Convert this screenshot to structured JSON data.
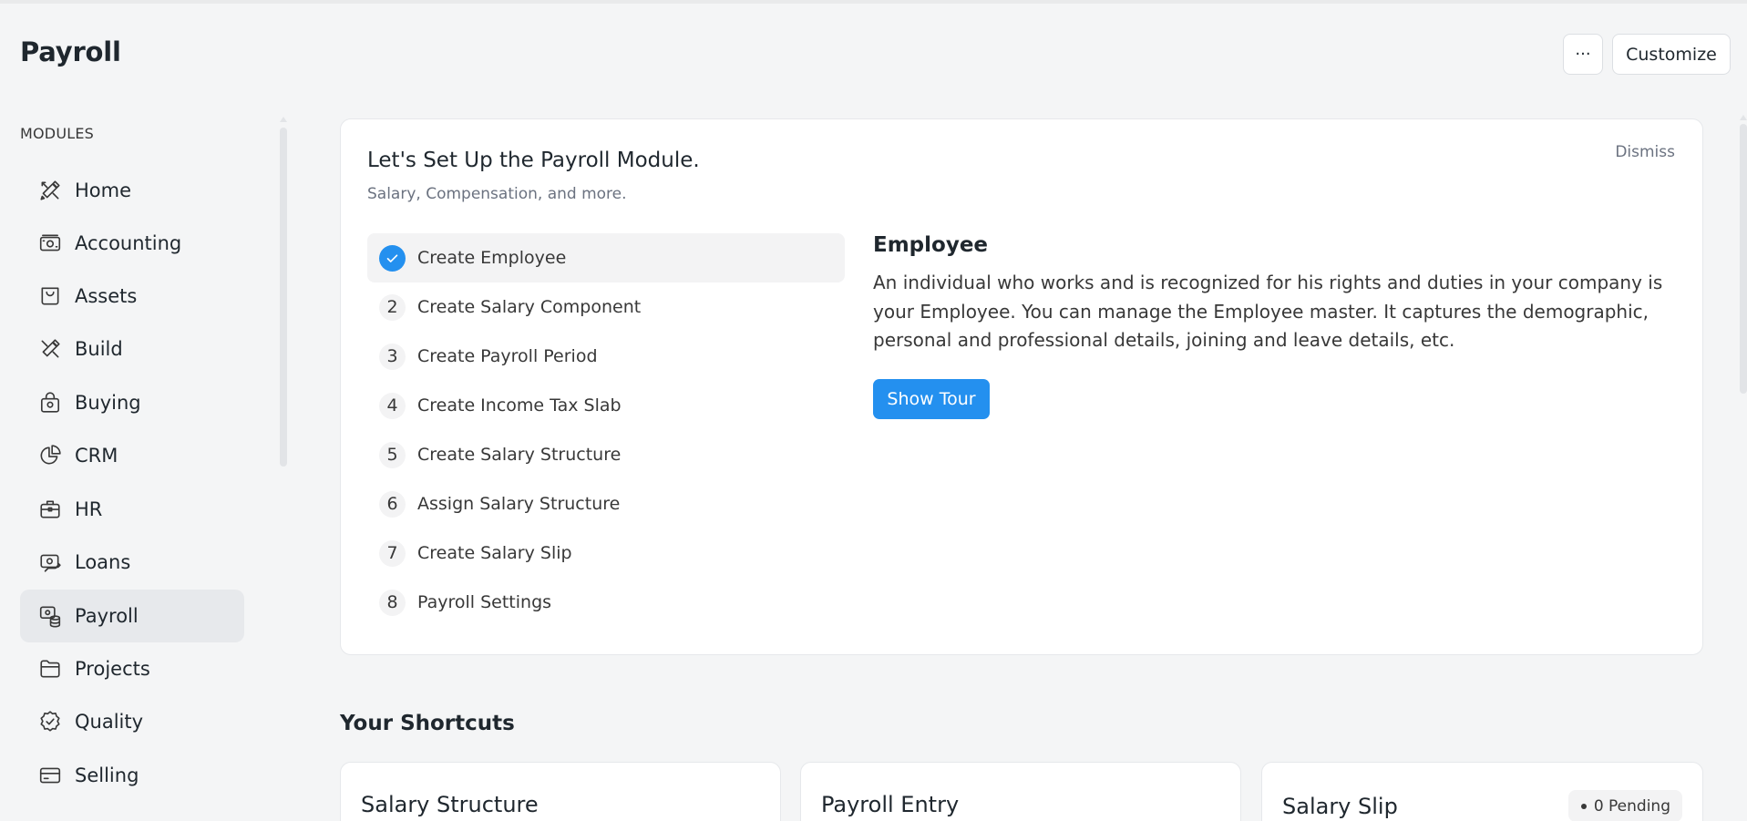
{
  "header": {
    "title": "Payroll",
    "more_label": "···",
    "customize_label": "Customize"
  },
  "sidebar": {
    "section_label": "MODULES",
    "items": [
      {
        "label": "Home",
        "icon": "tools-icon"
      },
      {
        "label": "Accounting",
        "icon": "money-icon"
      },
      {
        "label": "Assets",
        "icon": "bag-icon"
      },
      {
        "label": "Build",
        "icon": "tools-icon"
      },
      {
        "label": "Buying",
        "icon": "basket-icon"
      },
      {
        "label": "CRM",
        "icon": "pie-chart-icon"
      },
      {
        "label": "HR",
        "icon": "briefcase-icon"
      },
      {
        "label": "Loans",
        "icon": "loan-icon"
      },
      {
        "label": "Payroll",
        "icon": "payroll-icon",
        "active": true
      },
      {
        "label": "Projects",
        "icon": "folder-icon"
      },
      {
        "label": "Quality",
        "icon": "quality-badge-icon"
      },
      {
        "label": "Selling",
        "icon": "card-icon"
      }
    ]
  },
  "onboarding": {
    "title": "Let's Set Up the Payroll Module.",
    "subtitle": "Salary, Compensation, and more.",
    "dismiss_label": "Dismiss",
    "steps": [
      {
        "number": "✓",
        "label": "Create Employee",
        "done": true
      },
      {
        "number": "2",
        "label": "Create Salary Component"
      },
      {
        "number": "3",
        "label": "Create Payroll Period"
      },
      {
        "number": "4",
        "label": "Create Income Tax Slab"
      },
      {
        "number": "5",
        "label": "Create Salary Structure"
      },
      {
        "number": "6",
        "label": "Assign Salary Structure"
      },
      {
        "number": "7",
        "label": "Create Salary Slip"
      },
      {
        "number": "8",
        "label": "Payroll Settings"
      }
    ],
    "detail": {
      "title": "Employee",
      "body": "An individual who works and is recognized for his rights and duties in your company is your Employee. You can manage the Employee master. It captures the demographic, personal and professional details, joining and leave details, etc.",
      "button_label": "Show Tour"
    }
  },
  "shortcuts": {
    "title": "Your Shortcuts",
    "items": [
      {
        "label": "Salary Structure"
      },
      {
        "label": "Payroll Entry"
      },
      {
        "label": "Salary Slip",
        "badge": "0 Pending"
      }
    ]
  },
  "colors": {
    "accent": "#2490ef",
    "background": "#f4f5f6",
    "active_item": "#e7e9ec"
  }
}
